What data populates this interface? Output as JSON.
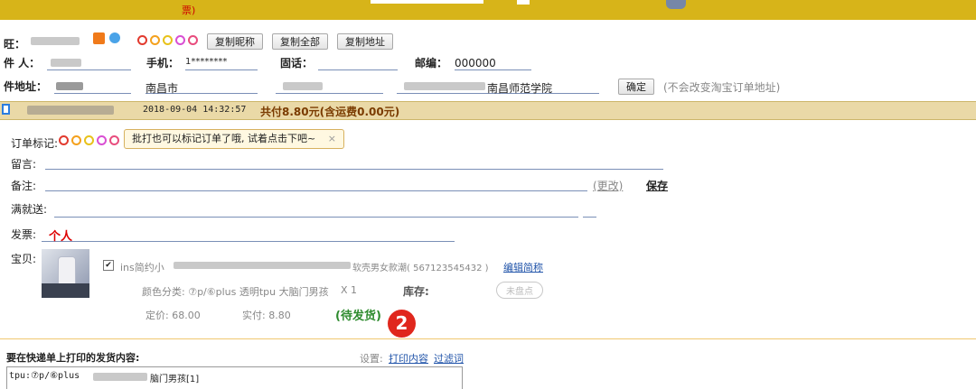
{
  "header": {
    "partial_text": "票)",
    "wangwang_label": "旺：",
    "buttons": {
      "copy_nick": "复制昵称",
      "copy_all": "复制全部",
      "copy_address": "复制地址"
    },
    "receiver_label": "件 人：",
    "phone_label": "手机：",
    "phone_value": "1********",
    "landline_label": "固话：",
    "zip_label": "邮编：",
    "zip_value": "000000",
    "address_label": "件地址：",
    "city": "南昌市",
    "address_suffix": "南昌师范学院",
    "confirm_button": "确定",
    "note": "(不会改变淘宝订单地址)"
  },
  "order": {
    "datetime": "2018-09-04 14:32:57",
    "total": "共付8.80元(含运费0.00元)",
    "mark_label": "订单标记:",
    "mark_tip": "批打也可以标记订单了哦, 试着点击下吧~",
    "mark_tip_close": "×",
    "message_label": "留言:",
    "remark_label": "备注:",
    "change_link": "(更改)",
    "save_button": "保存",
    "gift_label": "满就送:",
    "invoice_label": "发票:",
    "invoice_value": "个人",
    "item_label": "宝贝:",
    "item_title_start": "ins简约小",
    "item_title_end": "软壳男女款潮( 567123545432 )",
    "edit_name_link": "编辑简称",
    "spec": "颜色分类: ⑦p/⑥plus 透明tpu 大脑门男孩",
    "qty": "X  1",
    "stock_label": "库存:",
    "stock_button": "未盘点",
    "price_label": "定价: 68.00",
    "paid_label": "实付: 8.80",
    "status": "(待发货)",
    "step_badge": "2"
  },
  "print_section": {
    "title": "要在快递单上打印的发货内容:",
    "settings_label": "设置:",
    "print_content_link": "打印内容",
    "filter_link": "过滤词",
    "content_start": "tpu:⑦p/⑥plus",
    "content_end": "脑门男孩[1]"
  },
  "colors": {
    "topbar": "#d7b419",
    "orderbar": "#ead9a7",
    "badge": "#e0271d"
  }
}
